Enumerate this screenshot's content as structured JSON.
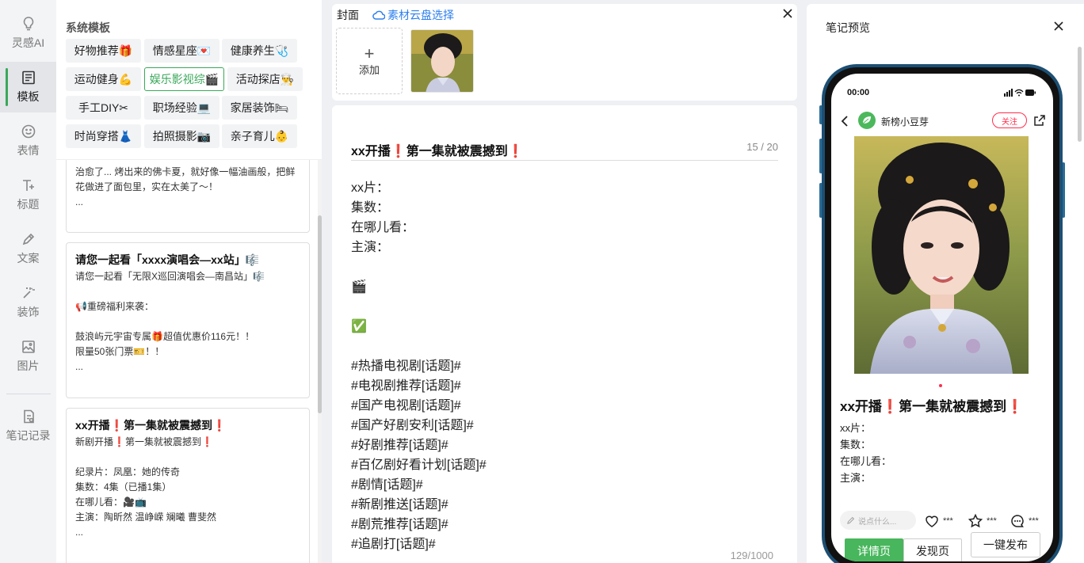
{
  "rail": {
    "items": [
      {
        "label": "灵感AI",
        "icon": "lightbulb-icon"
      },
      {
        "label": "模板",
        "icon": "template-icon"
      },
      {
        "label": "表情",
        "icon": "smiley-icon"
      },
      {
        "label": "标题",
        "icon": "title-icon"
      },
      {
        "label": "文案",
        "icon": "pen-icon"
      },
      {
        "label": "装饰",
        "icon": "sparkle-icon"
      },
      {
        "label": "图片",
        "icon": "image-icon"
      },
      {
        "label": "笔记记录",
        "icon": "notes-icon"
      }
    ],
    "active_index": 1
  },
  "templates": {
    "title": "系统模板",
    "categories": [
      "好物推荐🎁",
      "情感星座💌",
      "健康养生🩺",
      "运动健身💪",
      "娱乐影视综🎬",
      "活动探店👨‍🍳",
      "手工DIY✂",
      "职场经验💻",
      "家居装饰🛏",
      "时尚穿搭👗",
      "拍照摄影📷",
      "亲子育儿👶"
    ],
    "selected": "娱乐影视综🎬",
    "card0": {
      "lines": [
        "治愈了... 烤出来的佛卡夏，就好像一幅油画般，把鲜",
        "花做进了面包里，实在太美了～！",
        "..."
      ]
    },
    "card1": {
      "title": "请您一起看「xxxx演唱会—xx站」🎼",
      "lines": [
        "请您一起看「无限X巡回演唱会—南昌站」🎼",
        "",
        "📢重磅福利来袭：",
        "",
        "鼓浪屿元宇宙专属🎁超值优惠价116元！！",
        "限量50张门票🎫！！",
        "..."
      ]
    },
    "card2": {
      "title": "xx开播❗第一集就被震撼到❗",
      "lines": [
        "新剧开播❗第一集就被震撼到❗",
        "",
        "纪录片：凤凰：她的传奇",
        "集数：4集（已播1集）",
        "在哪儿看：🎥📺",
        "主演：陶昕然 温峥嵘 斓曦 曹斐然",
        "..."
      ]
    }
  },
  "cover": {
    "label": "封面",
    "cloud_link": "素材云盘选择",
    "add_label": "添加",
    "add_plus": "+"
  },
  "editor": {
    "title": "xx开播❗第一集就被震撼到❗",
    "title_count": "15 / 20",
    "lines": [
      "xx片：",
      "集数：",
      "在哪儿看：",
      "主演：",
      "",
      "🎬",
      "",
      "✅",
      "",
      "#热播电视剧[话题]#",
      "#电视剧推荐[话题]#",
      "#国产电视剧[话题]#",
      "#国产好剧安利[话题]#",
      "#好剧推荐[话题]#",
      "#百亿剧好看计划[话题]#",
      "#剧情[话题]#",
      "#新剧推送[话题]#",
      "#剧荒推荐[话题]#",
      "#追剧打[话题]#"
    ],
    "body_count": "129/1000"
  },
  "preview": {
    "title": "笔记预览",
    "time": "00:00",
    "author": "新榜小豆芽",
    "follow": "关注",
    "note_title": "xx开播❗第一集就被震撼到❗",
    "lines": [
      "xx片：",
      "集数：",
      "在哪儿看：",
      "主演："
    ],
    "comment_placeholder": "说点什么...",
    "like": "***",
    "star": "***",
    "comment": "***",
    "btn_detail": "详情页",
    "btn_discover": "发现页",
    "btn_publish": "一键发布"
  },
  "colors": {
    "accent": "#48b65c",
    "link": "#2f80ed",
    "follow": "#ff2e4d",
    "phone_frame": "#1c4f73"
  }
}
